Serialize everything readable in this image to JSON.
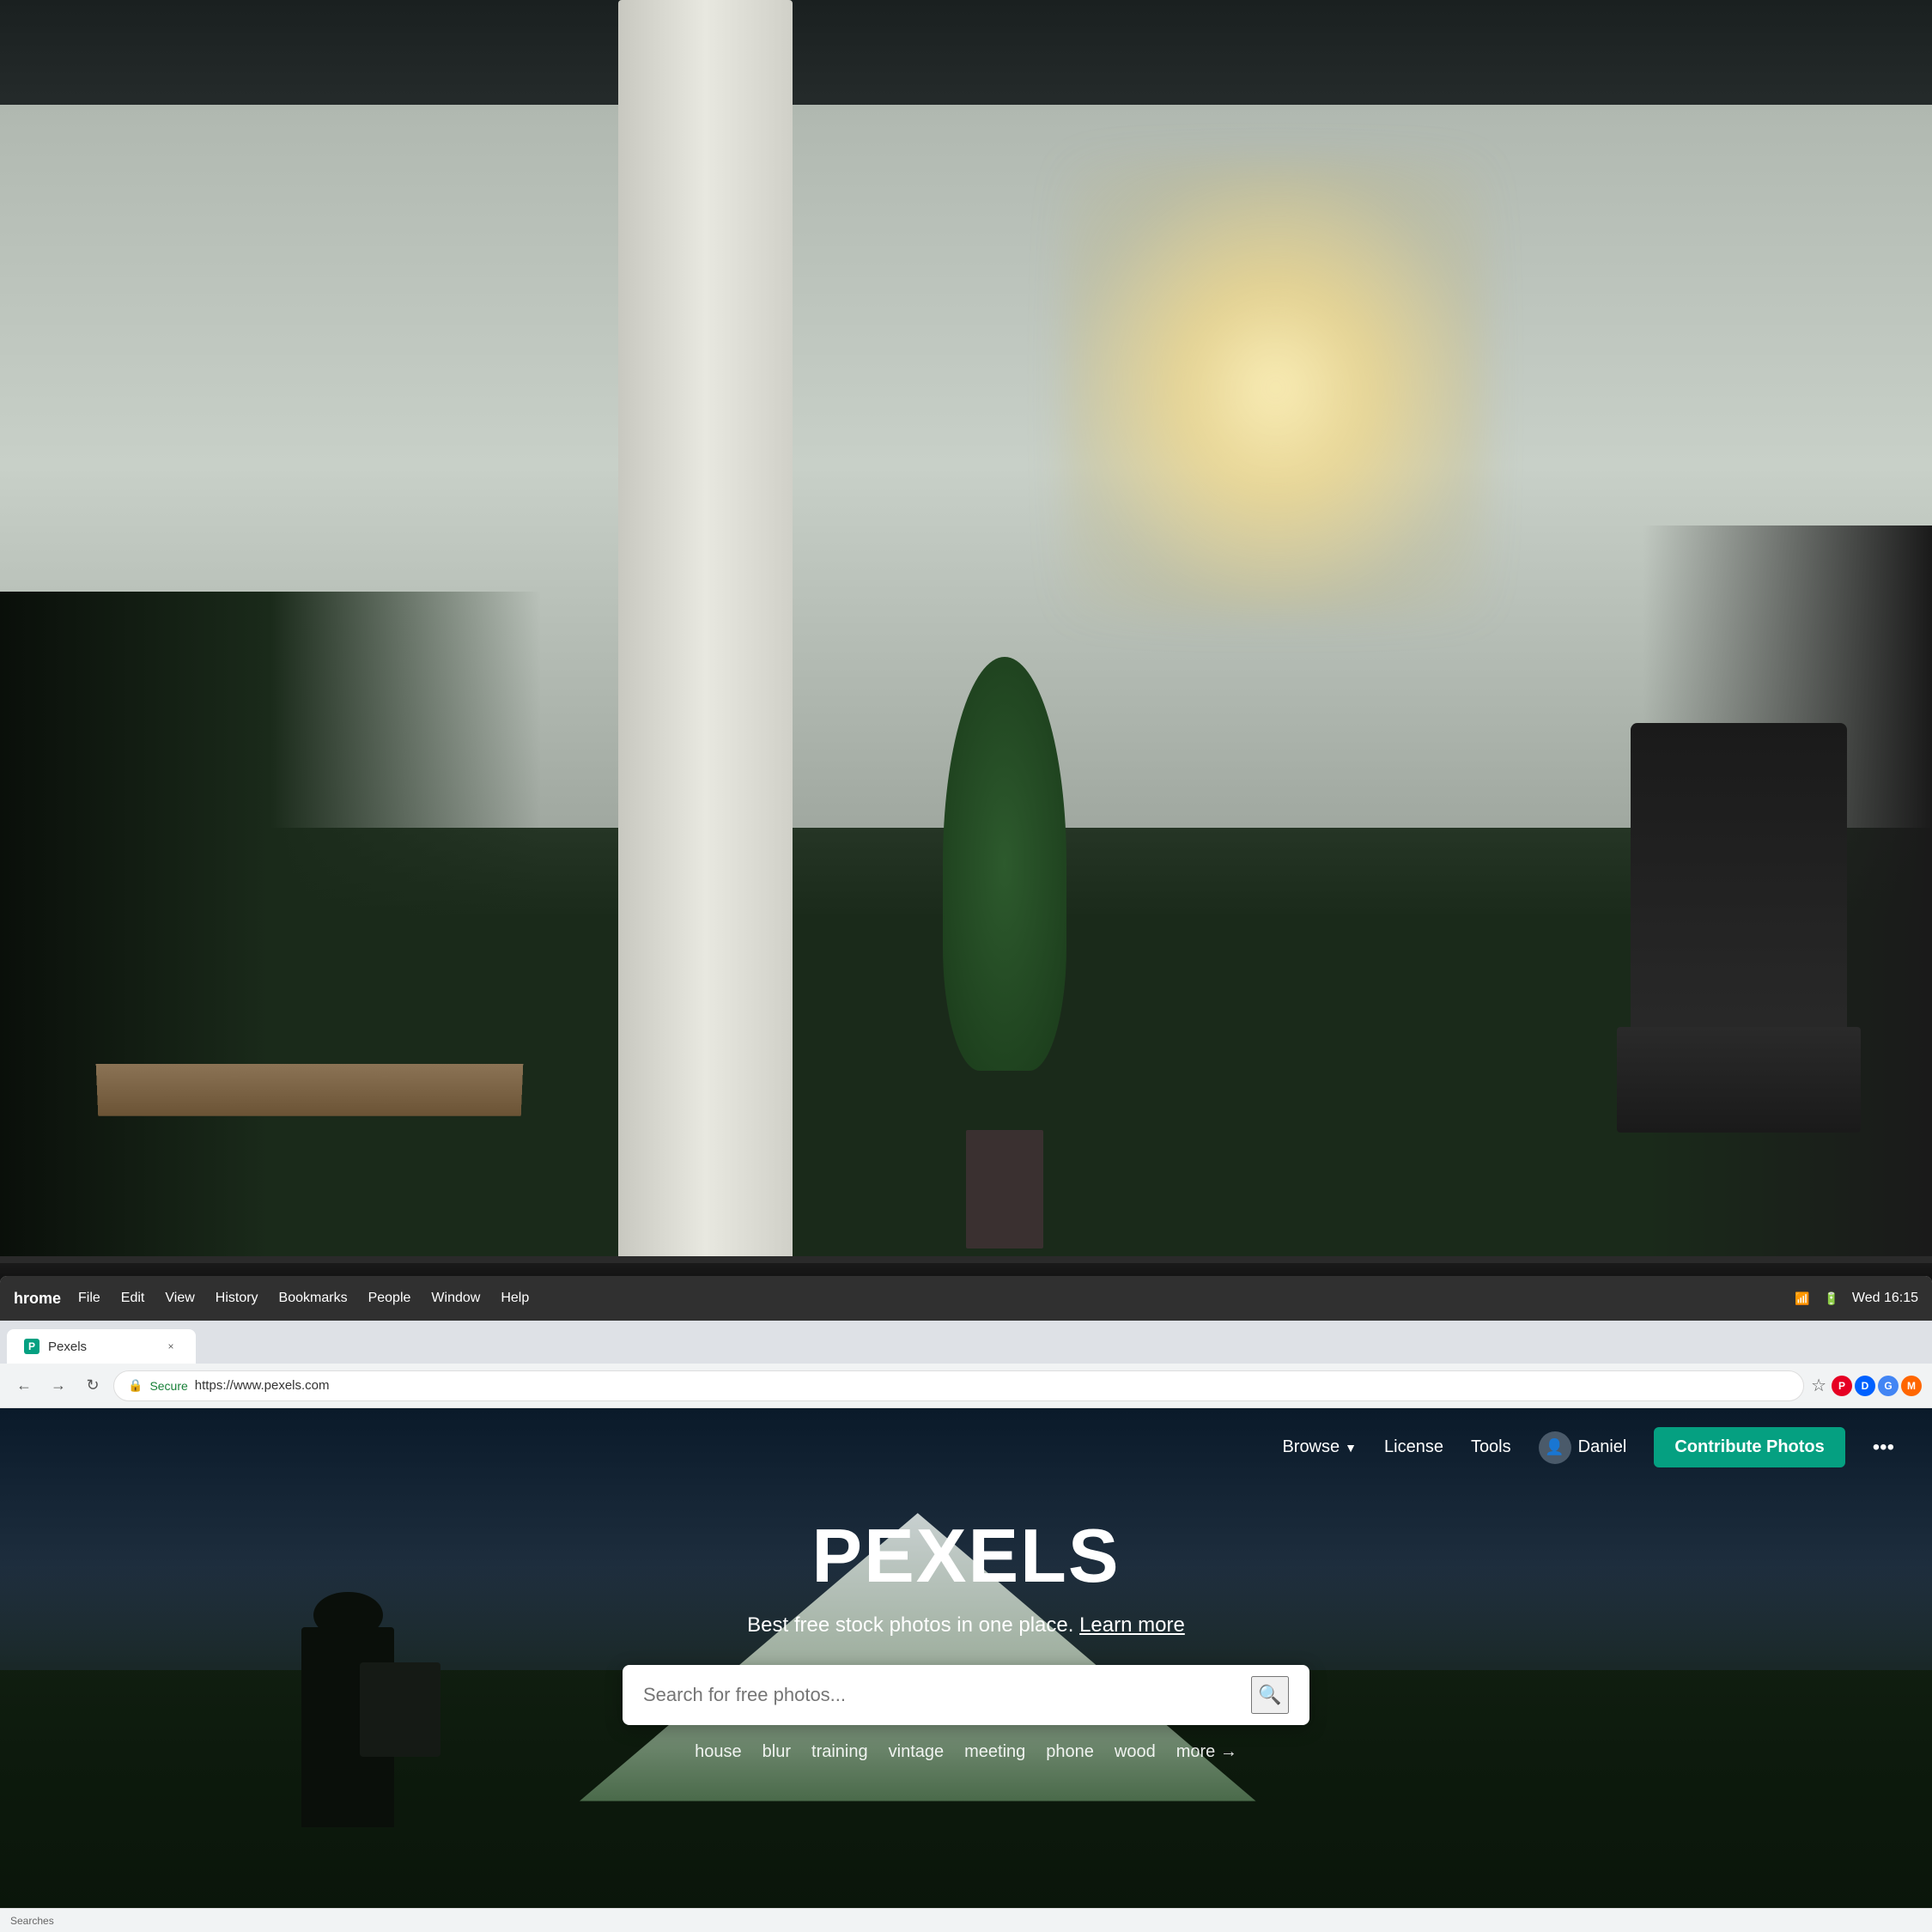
{
  "background": {
    "description": "Office workspace with pillar, windows, plants, chairs"
  },
  "os": {
    "menubar_items": [
      "File",
      "Edit",
      "View",
      "History",
      "Bookmarks",
      "People",
      "Window",
      "Help"
    ],
    "app_name": "hrome",
    "time": "Wed 16:15",
    "battery": "100%"
  },
  "browser": {
    "tab_label": "Pexels",
    "url_protocol": "Secure",
    "url": "https://www.pexels.com",
    "tab_close_icon": "×"
  },
  "pexels": {
    "nav": {
      "browse_label": "Browse",
      "license_label": "License",
      "tools_label": "Tools",
      "user_name": "Daniel",
      "contribute_label": "Contribute Photos",
      "more_icon": "•••"
    },
    "hero": {
      "title": "PEXELS",
      "subtitle": "Best free stock photos in one place.",
      "learn_more": "Learn more",
      "search_placeholder": "Search for free photos...",
      "quick_tags": [
        "house",
        "blur",
        "training",
        "vintage",
        "meeting",
        "phone",
        "wood"
      ],
      "more_label": "more →"
    }
  },
  "status_bar": {
    "text": "Searches"
  }
}
